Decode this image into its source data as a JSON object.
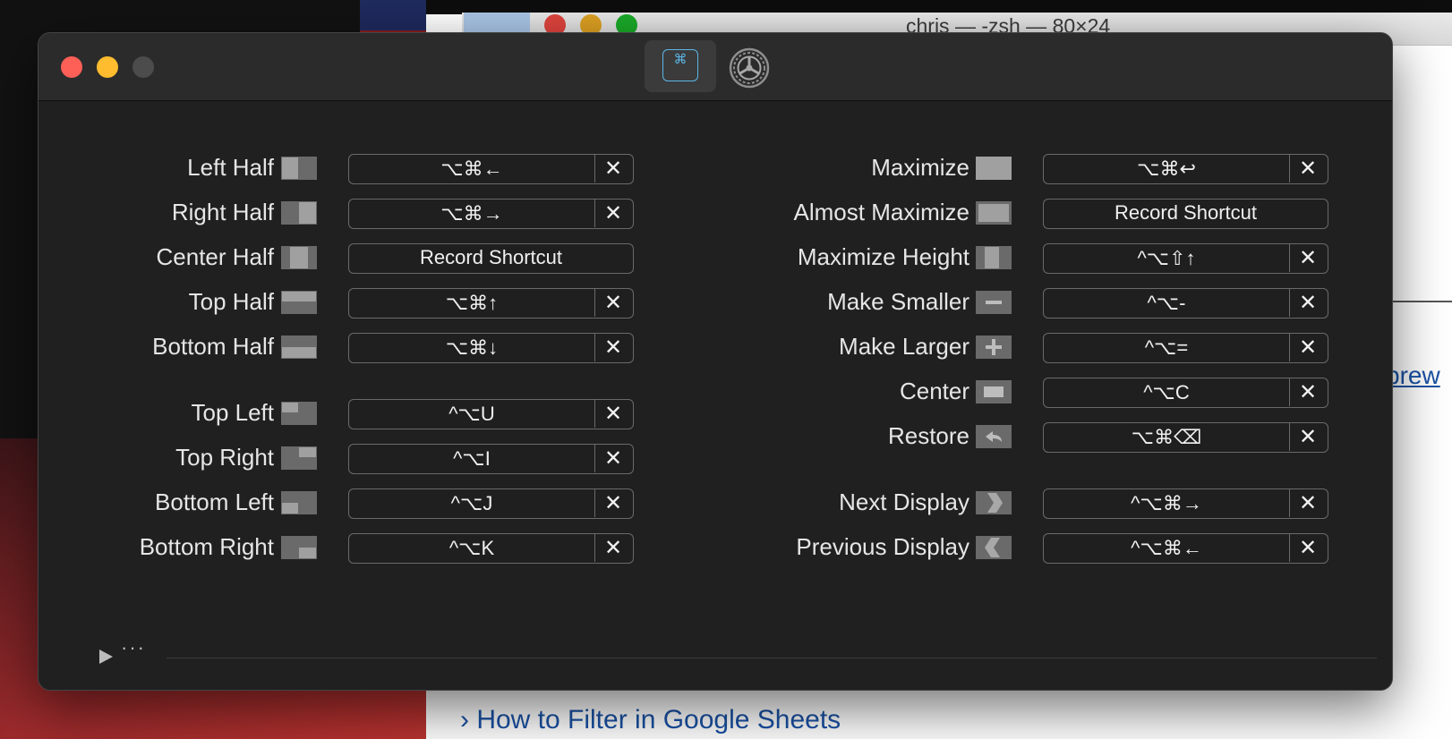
{
  "background": {
    "terminal_title": "chris — -zsh — 80×24",
    "link_right": "brew",
    "link_bottom": "› How to Filter in Google Sheets"
  },
  "toolbar": {
    "shortcuts_tab_glyph": "⌘",
    "shortcuts_icon": "command-key-icon",
    "settings_icon": "gear-icon"
  },
  "colors": {
    "accent": "#5cb6e8",
    "close": "#fe5f57",
    "minimize": "#febc2e"
  },
  "left_column": [
    {
      "label": "Left Half",
      "icon": "left-half-icon",
      "shortcut": "⌥⌘←",
      "clear": "✕"
    },
    {
      "label": "Right Half",
      "icon": "right-half-icon",
      "shortcut": "⌥⌘→",
      "clear": "✕"
    },
    {
      "label": "Center Half",
      "icon": "center-half-icon",
      "shortcut": "Record Shortcut",
      "clear": ""
    },
    {
      "label": "Top Half",
      "icon": "top-half-icon",
      "shortcut": "⌥⌘↑",
      "clear": "✕"
    },
    {
      "label": "Bottom Half",
      "icon": "bottom-half-icon",
      "shortcut": "⌥⌘↓",
      "clear": "✕"
    },
    {
      "label": "Top Left",
      "icon": "top-left-icon",
      "shortcut": "^⌥U",
      "clear": "✕"
    },
    {
      "label": "Top Right",
      "icon": "top-right-icon",
      "shortcut": "^⌥I",
      "clear": "✕"
    },
    {
      "label": "Bottom Left",
      "icon": "bottom-left-icon",
      "shortcut": "^⌥J",
      "clear": "✕"
    },
    {
      "label": "Bottom Right",
      "icon": "bottom-right-icon",
      "shortcut": "^⌥K",
      "clear": "✕"
    }
  ],
  "right_column": [
    {
      "label": "Maximize",
      "icon": "maximize-icon",
      "shortcut": "⌥⌘↩",
      "clear": "✕"
    },
    {
      "label": "Almost Maximize",
      "icon": "almost-maximize-icon",
      "shortcut": "Record Shortcut",
      "clear": ""
    },
    {
      "label": "Maximize Height",
      "icon": "maximize-height-icon",
      "shortcut": "^⌥⇧↑",
      "clear": "✕"
    },
    {
      "label": "Make Smaller",
      "icon": "make-smaller-icon",
      "shortcut": "^⌥-",
      "clear": "✕"
    },
    {
      "label": "Make Larger",
      "icon": "make-larger-icon",
      "shortcut": "^⌥=",
      "clear": "✕"
    },
    {
      "label": "Center",
      "icon": "center-icon",
      "shortcut": "^⌥C",
      "clear": "✕"
    },
    {
      "label": "Restore",
      "icon": "restore-icon",
      "shortcut": "⌥⌘⌫",
      "clear": "✕"
    },
    {
      "label": "Next Display",
      "icon": "next-display-icon",
      "shortcut": "^⌥⌘→",
      "clear": "✕"
    },
    {
      "label": "Previous Display",
      "icon": "previous-display-icon",
      "shortcut": "^⌥⌘←",
      "clear": "✕"
    }
  ],
  "footer": {
    "expand_icon": "play-triangle-icon",
    "dots": "···"
  }
}
